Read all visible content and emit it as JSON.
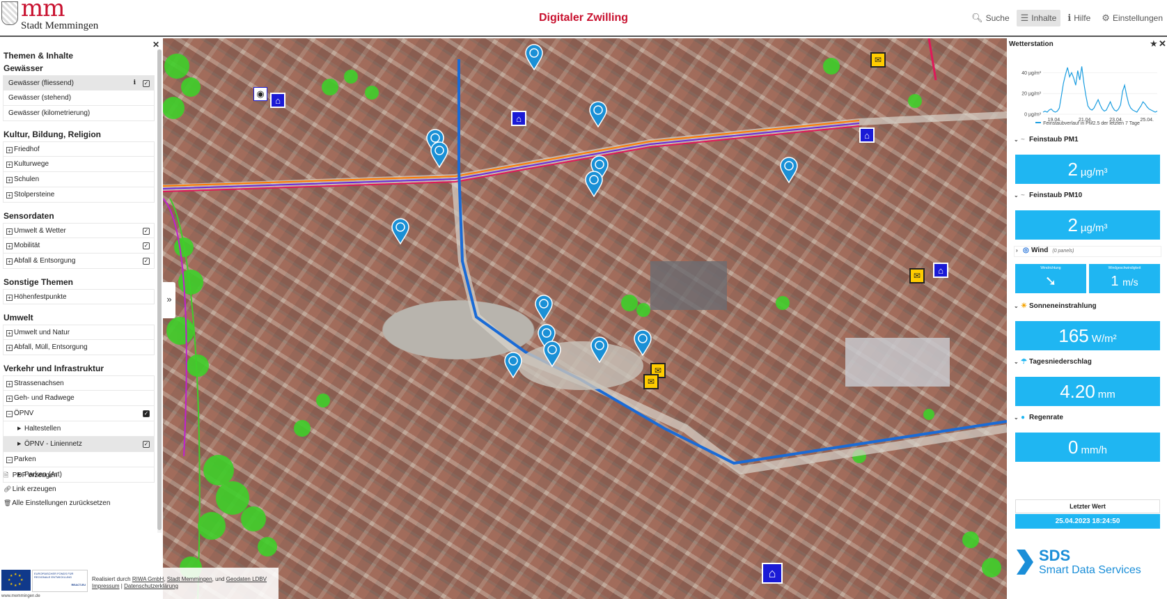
{
  "header": {
    "logo_text": "mm",
    "city_name": "Stadt Memmingen",
    "title": "Digitaler Zwilling",
    "nav": [
      {
        "label": "Suche",
        "icon": "search-icon"
      },
      {
        "label": "Inhalte",
        "icon": "menu-icon"
      },
      {
        "label": "Hilfe",
        "icon": "info-icon"
      },
      {
        "label": "Einstellungen",
        "icon": "gear-icon"
      }
    ]
  },
  "left_panel": {
    "panel_title": "Themen & Inhalte",
    "sections": {
      "gewaesser": {
        "title": "Gewässer",
        "items": [
          "Gewässer (fliessend)",
          "Gewässer (stehend)",
          "Gewässer (kilometrierung)"
        ]
      },
      "kultur": {
        "title": "Kultur, Bildung, Religion",
        "items": [
          "Friedhof",
          "Kulturwege",
          "Schulen",
          "Stolpersteine"
        ]
      },
      "sensor": {
        "title": "Sensordaten",
        "items": [
          "Umwelt & Wetter",
          "Mobilität",
          "Abfall & Entsorgung"
        ]
      },
      "sonstige": {
        "title": "Sonstige Themen",
        "items": [
          "Höhenfestpunkte"
        ]
      },
      "umwelt": {
        "title": "Umwelt",
        "items": [
          "Umwelt und Natur",
          "Abfall, Müll, Entsorgung"
        ]
      },
      "verkehr": {
        "title": "Verkehr und Infrastruktur",
        "items": [
          "Strassenachsen",
          "Geh- und Radwege",
          "ÖPNV",
          "Haltestellen",
          "ÖPNV - Liniennetz",
          "Parken",
          "Parken (Art)"
        ]
      }
    },
    "actions": [
      "PDF erzeugen",
      "Link erzeugen",
      "Alle Einstellungen zurücksetzen"
    ]
  },
  "footer": {
    "efre_text": "EUROPÄISCHER FONDS FÜR REGIONALE ENTWICKLUNG",
    "react_eu": "REACT-EU",
    "realized_by": "Realisiert durch",
    "partner1": "RIWA GmbH",
    "partner2": "Stadt Memmingen",
    "partner3": "Geodaten LDBV",
    "and_text": "und",
    "impressum": "Impressum",
    "datenschutz": "Datenschutzerklärung",
    "domain": "www.memmingen.de"
  },
  "right_panel": {
    "title": "Wetterstation",
    "chart_caption": "Feinstaubverlauf in PM2.5 der letzten 7 Tage",
    "sections": {
      "pm1": {
        "label": "Feinstaub PM1",
        "value": "2",
        "unit": "µg/m³"
      },
      "pm10": {
        "label": "Feinstaub PM10",
        "value": "2",
        "unit": "µg/m³"
      },
      "wind": {
        "label": "Wind",
        "note": "(0 panels)",
        "dir_label": "Windrichtung",
        "speed_label": "Windgeschwindigkeit",
        "speed_value": "1",
        "speed_unit": "m/s"
      },
      "sun": {
        "label": "Sonneneinstrahlung",
        "value": "165",
        "unit": "W/m²"
      },
      "rain": {
        "label": "Tagesniederschlag",
        "value": "4.20",
        "unit": "mm"
      },
      "rate": {
        "label": "Regenrate",
        "value": "0",
        "unit": "mm/h"
      }
    },
    "last_value_label": "Letzter Wert",
    "last_value": "25.04.2023 18:24:50",
    "sds_big": "SDS",
    "sds_small": "Smart Data Services"
  },
  "chart_data": {
    "type": "line",
    "title": "",
    "xlabel": "",
    "ylabel": "",
    "x_ticks": [
      "19.04.",
      "21.04.",
      "23.04.",
      "25.04."
    ],
    "y_ticks": [
      "0 µg/m³",
      "20 µg/m³",
      "40 µg/m³"
    ],
    "ylim": [
      0,
      55
    ],
    "series": [
      {
        "name": "Feinstaubverlauf in PM2.5 der letzten 7 Tage",
        "values": [
          2,
          3,
          2,
          4,
          5,
          3,
          2,
          3,
          6,
          18,
          30,
          38,
          45,
          36,
          40,
          35,
          28,
          42,
          33,
          46,
          30,
          18,
          8,
          5,
          4,
          6,
          10,
          14,
          9,
          5,
          3,
          4,
          8,
          12,
          7,
          4,
          3,
          5,
          9,
          22,
          28,
          18,
          10,
          6,
          4,
          3,
          2,
          5,
          8,
          12,
          10,
          7,
          5,
          4,
          3,
          2,
          3
        ]
      }
    ]
  },
  "colors": {
    "brand_red": "#c8102e",
    "tile_blue": "#1fb6f2",
    "marker_blue": "#1a1ad6",
    "post_yellow": "#ffcc00"
  }
}
